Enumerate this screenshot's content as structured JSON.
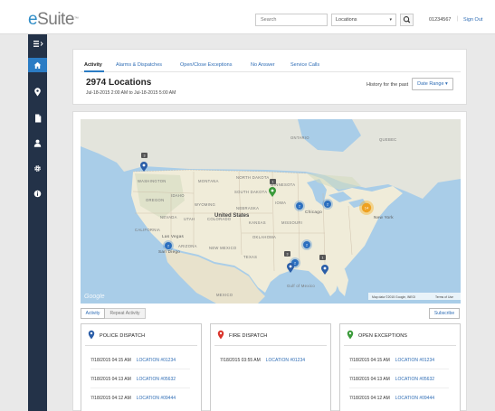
{
  "header": {
    "logo_prefix": "e",
    "logo_rest": "Suite",
    "logo_mark": "™",
    "search_placeholder": "Search",
    "location_select": "Locations",
    "account_number": "01234567",
    "separator": "|",
    "sign_out": "Sign Out"
  },
  "sidebar": {
    "items": [
      {
        "icon": "menu-icon"
      },
      {
        "icon": "home-icon"
      },
      {
        "icon": "location-pin-icon"
      },
      {
        "icon": "document-icon"
      },
      {
        "icon": "user-icon"
      },
      {
        "icon": "gear-icon"
      },
      {
        "icon": "info-icon"
      }
    ]
  },
  "activity": {
    "tabs": [
      "Activity",
      "Alarms & Dispatches",
      "Open/Close Exceptions",
      "No Answer",
      "Service Calls"
    ],
    "count_title": "2974 Locations",
    "range": "Jul-18-2015 2:00 AM to Jul-18-2015 5:00 AM",
    "history_label": "History for the past",
    "date_range_button": "Date Range ▾"
  },
  "map": {
    "country_label": "United States",
    "labels": [
      "ONTARIO",
      "QUEBEC",
      "WASHINGTON",
      "MONTANA",
      "NORTH DAKOTA",
      "MINNESOTA",
      "OREGON",
      "IDAHO",
      "SOUTH DAKOTA",
      "WYOMING",
      "NEBRASKA",
      "IOWA",
      "NEVADA",
      "UTAH",
      "COLORADO",
      "KANSAS",
      "MISSOURI",
      "CALIFORNIA",
      "ARIZONA",
      "NEW MEXICO",
      "OKLAHOMA",
      "TEXAS",
      "Gulf of Mexico",
      "New York",
      "Chicago",
      "Las Vegas",
      "San Diego",
      "MEXICO"
    ],
    "clusters": [
      {
        "label": "2"
      },
      {
        "label": "2"
      },
      {
        "label": "2"
      },
      {
        "label": "2"
      },
      {
        "label": "2"
      },
      {
        "label": "14"
      }
    ],
    "count_badges": [
      "3",
      "1",
      "3",
      "1"
    ],
    "attribution": "Map data ©2015 Google, INEGI",
    "terms": "Terms of Use",
    "google_logo": "Google"
  },
  "controls": {
    "activity_button": "Activity",
    "repeat_button": "Repeat Activity",
    "subscribe_button": "Subscribe"
  },
  "cards": [
    {
      "title": "POLICE DISPATCH",
      "pin_color": "#2b5ea8",
      "rows": [
        {
          "time": "7/18/2015 04:15 AM",
          "loc": "LOCATION #01234"
        },
        {
          "time": "7/18/2015 04:13 AM",
          "loc": "LOCATION #05632"
        },
        {
          "time": "7/18/2015 04:12 AM",
          "loc": "LOCATION #09444"
        }
      ]
    },
    {
      "title": "FIRE DISPATCH",
      "pin_color": "#d9342b",
      "rows": [
        {
          "time": "7/18/2015 03:55 AM",
          "loc": "LOCATION #01234"
        }
      ]
    },
    {
      "title": "OPEN EXCEPTIONS",
      "pin_color": "#3a9a3a",
      "rows": [
        {
          "time": "7/18/2015 04:15 AM",
          "loc": "LOCATION #01234"
        },
        {
          "time": "7/18/2015 04:13 AM",
          "loc": "LOCATION #05632"
        },
        {
          "time": "7/18/2015 04:12 AM",
          "loc": "LOCATION #09444"
        }
      ]
    }
  ]
}
